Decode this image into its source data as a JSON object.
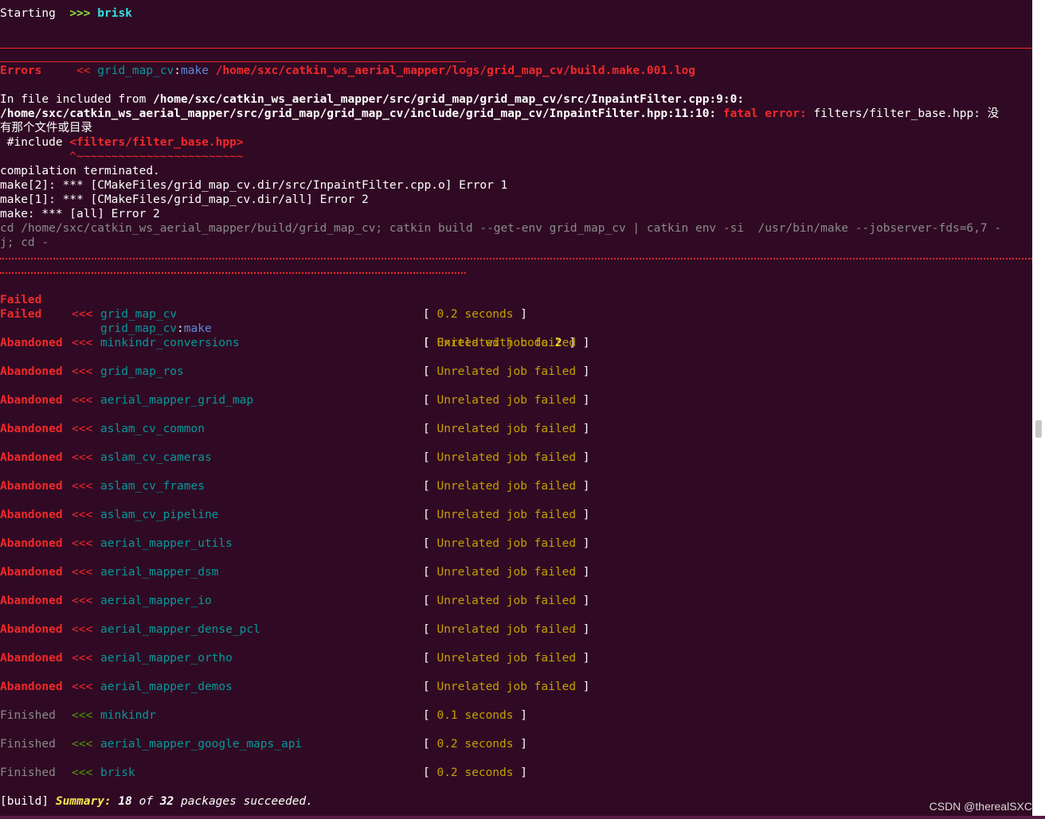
{
  "header": {
    "starting_label": "Starting",
    "arrows": ">>>",
    "package": "brisk"
  },
  "error_block": {
    "errors_label": "Errors",
    "arrows": "<<",
    "package": "grid_map_cv",
    "colon": ":",
    "stage": "make",
    "log_path": "/home/sxc/catkin_ws_aerial_mapper/logs/grid_map_cv/build.make.001.log",
    "included_prefix": "In file included from ",
    "included_path": "/home/sxc/catkin_ws_aerial_mapper/src/grid_map/grid_map_cv/src/InpaintFilter.cpp:9:0:",
    "header_path": "/home/sxc/catkin_ws_aerial_mapper/src/grid_map/grid_map_cv/include/grid_map_cv/InpaintFilter.hpp:11:10: ",
    "fatal": "fatal",
    "error_word": "error:",
    "missing_file": " filters/filter_base.hpp: 没",
    "missing_file_cont": "有那个文件或目录",
    "include_prefix": " #include ",
    "include_target": "<filters/filter_base.hpp>",
    "caret_line": "          ^~~~~~~~~~~~~~~~~~~~~~~~~",
    "compilation": "compilation terminated.",
    "make2": "make[2]: *** [CMakeFiles/grid_map_cv.dir/src/InpaintFilter.cpp.o] Error 1",
    "make1": "make[1]: *** [CMakeFiles/grid_map_cv.dir/all] Error 2",
    "make0": "make: *** [all] Error 2",
    "cd_line1": "cd /home/sxc/catkin_ws_aerial_mapper/build/grid_map_cv; catkin build --get-env grid_map_cv | catkin env -si  /usr/bin/make --jobserver-fds=6,7 -",
    "cd_line2": "j; cd -"
  },
  "failed_make": {
    "label": "Failed",
    "arrows": "<<",
    "package": "grid_map_cv",
    "colon": ":",
    "stage": "make",
    "status_prefix": "Exited with code",
    "code": "2"
  },
  "jobs": [
    {
      "label": "Failed",
      "arrows": "<<<",
      "package": "grid_map_cv",
      "status": "0.2 seconds",
      "kind": "failed"
    },
    {
      "label": "Abandoned",
      "arrows": "<<<",
      "package": "minkindr_conversions",
      "status": "Unrelated job failed",
      "kind": "abandoned"
    },
    {
      "label": "Abandoned",
      "arrows": "<<<",
      "package": "grid_map_ros",
      "status": "Unrelated job failed",
      "kind": "abandoned"
    },
    {
      "label": "Abandoned",
      "arrows": "<<<",
      "package": "aerial_mapper_grid_map",
      "status": "Unrelated job failed",
      "kind": "abandoned"
    },
    {
      "label": "Abandoned",
      "arrows": "<<<",
      "package": "aslam_cv_common",
      "status": "Unrelated job failed",
      "kind": "abandoned"
    },
    {
      "label": "Abandoned",
      "arrows": "<<<",
      "package": "aslam_cv_cameras",
      "status": "Unrelated job failed",
      "kind": "abandoned"
    },
    {
      "label": "Abandoned",
      "arrows": "<<<",
      "package": "aslam_cv_frames",
      "status": "Unrelated job failed",
      "kind": "abandoned"
    },
    {
      "label": "Abandoned",
      "arrows": "<<<",
      "package": "aslam_cv_pipeline",
      "status": "Unrelated job failed",
      "kind": "abandoned"
    },
    {
      "label": "Abandoned",
      "arrows": "<<<",
      "package": "aerial_mapper_utils",
      "status": "Unrelated job failed",
      "kind": "abandoned"
    },
    {
      "label": "Abandoned",
      "arrows": "<<<",
      "package": "aerial_mapper_dsm",
      "status": "Unrelated job failed",
      "kind": "abandoned"
    },
    {
      "label": "Abandoned",
      "arrows": "<<<",
      "package": "aerial_mapper_io",
      "status": "Unrelated job failed",
      "kind": "abandoned"
    },
    {
      "label": "Abandoned",
      "arrows": "<<<",
      "package": "aerial_mapper_dense_pcl",
      "status": "Unrelated job failed",
      "kind": "abandoned"
    },
    {
      "label": "Abandoned",
      "arrows": "<<<",
      "package": "aerial_mapper_ortho",
      "status": "Unrelated job failed",
      "kind": "abandoned"
    },
    {
      "label": "Abandoned",
      "arrows": "<<<",
      "package": "aerial_mapper_demos",
      "status": "Unrelated job failed",
      "kind": "abandoned"
    },
    {
      "label": "Finished",
      "arrows": "<<<",
      "package": "minkindr",
      "status": "0.1 seconds",
      "kind": "finished"
    },
    {
      "label": "Finished",
      "arrows": "<<<",
      "package": "aerial_mapper_google_maps_api",
      "status": "0.2 seconds",
      "kind": "finished"
    },
    {
      "label": "Finished",
      "arrows": "<<<",
      "package": "brisk",
      "status": "0.2 seconds",
      "kind": "finished"
    }
  ],
  "summary": {
    "prefix": "[build] ",
    "label": "Summary:",
    "succeeded": "18",
    "of_word": "of",
    "total": "32",
    "suffix": "packages succeeded."
  },
  "bracket_open": "[ ",
  "bracket_close": " ]",
  "watermark": "CSDN @therealSXC",
  "colors": {
    "background": "#300a24",
    "error_red": "#ef2929",
    "package_cyan": "#06989a",
    "status_yellow": "#c4a000",
    "finished_gray": "#8a8a8a"
  }
}
